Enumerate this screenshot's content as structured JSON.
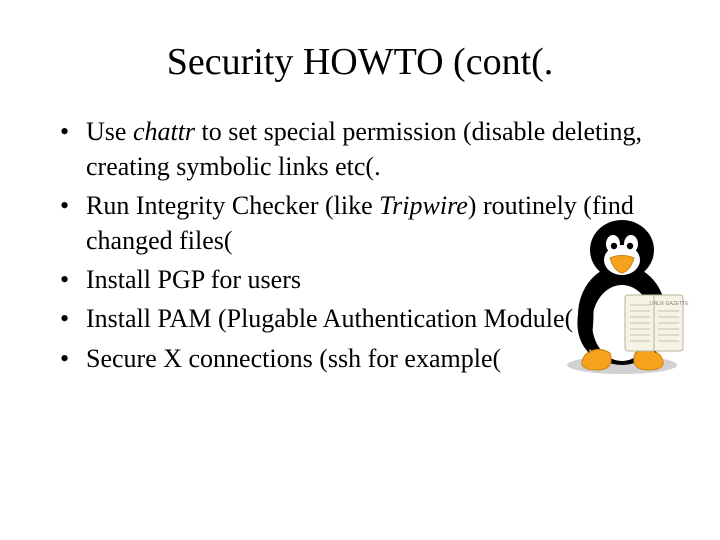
{
  "title": "Security HOWTO (cont(.",
  "bullets": {
    "b1a": "Use ",
    "b1b": "chattr",
    "b1c": " to set special permission (disable deleting, creating symbolic links etc(.",
    "b2a": "Run Integrity Checker (like ",
    "b2b": "Tripwire",
    "b2c": ") routinely (find changed files(",
    "b3": "Install PGP for users",
    "b4": "Install PAM (Plugable Authentication Module(",
    "b5": "Secure X connections (ssh for example("
  },
  "tux": {
    "gazette_label": "LINUX GAZETTE"
  }
}
